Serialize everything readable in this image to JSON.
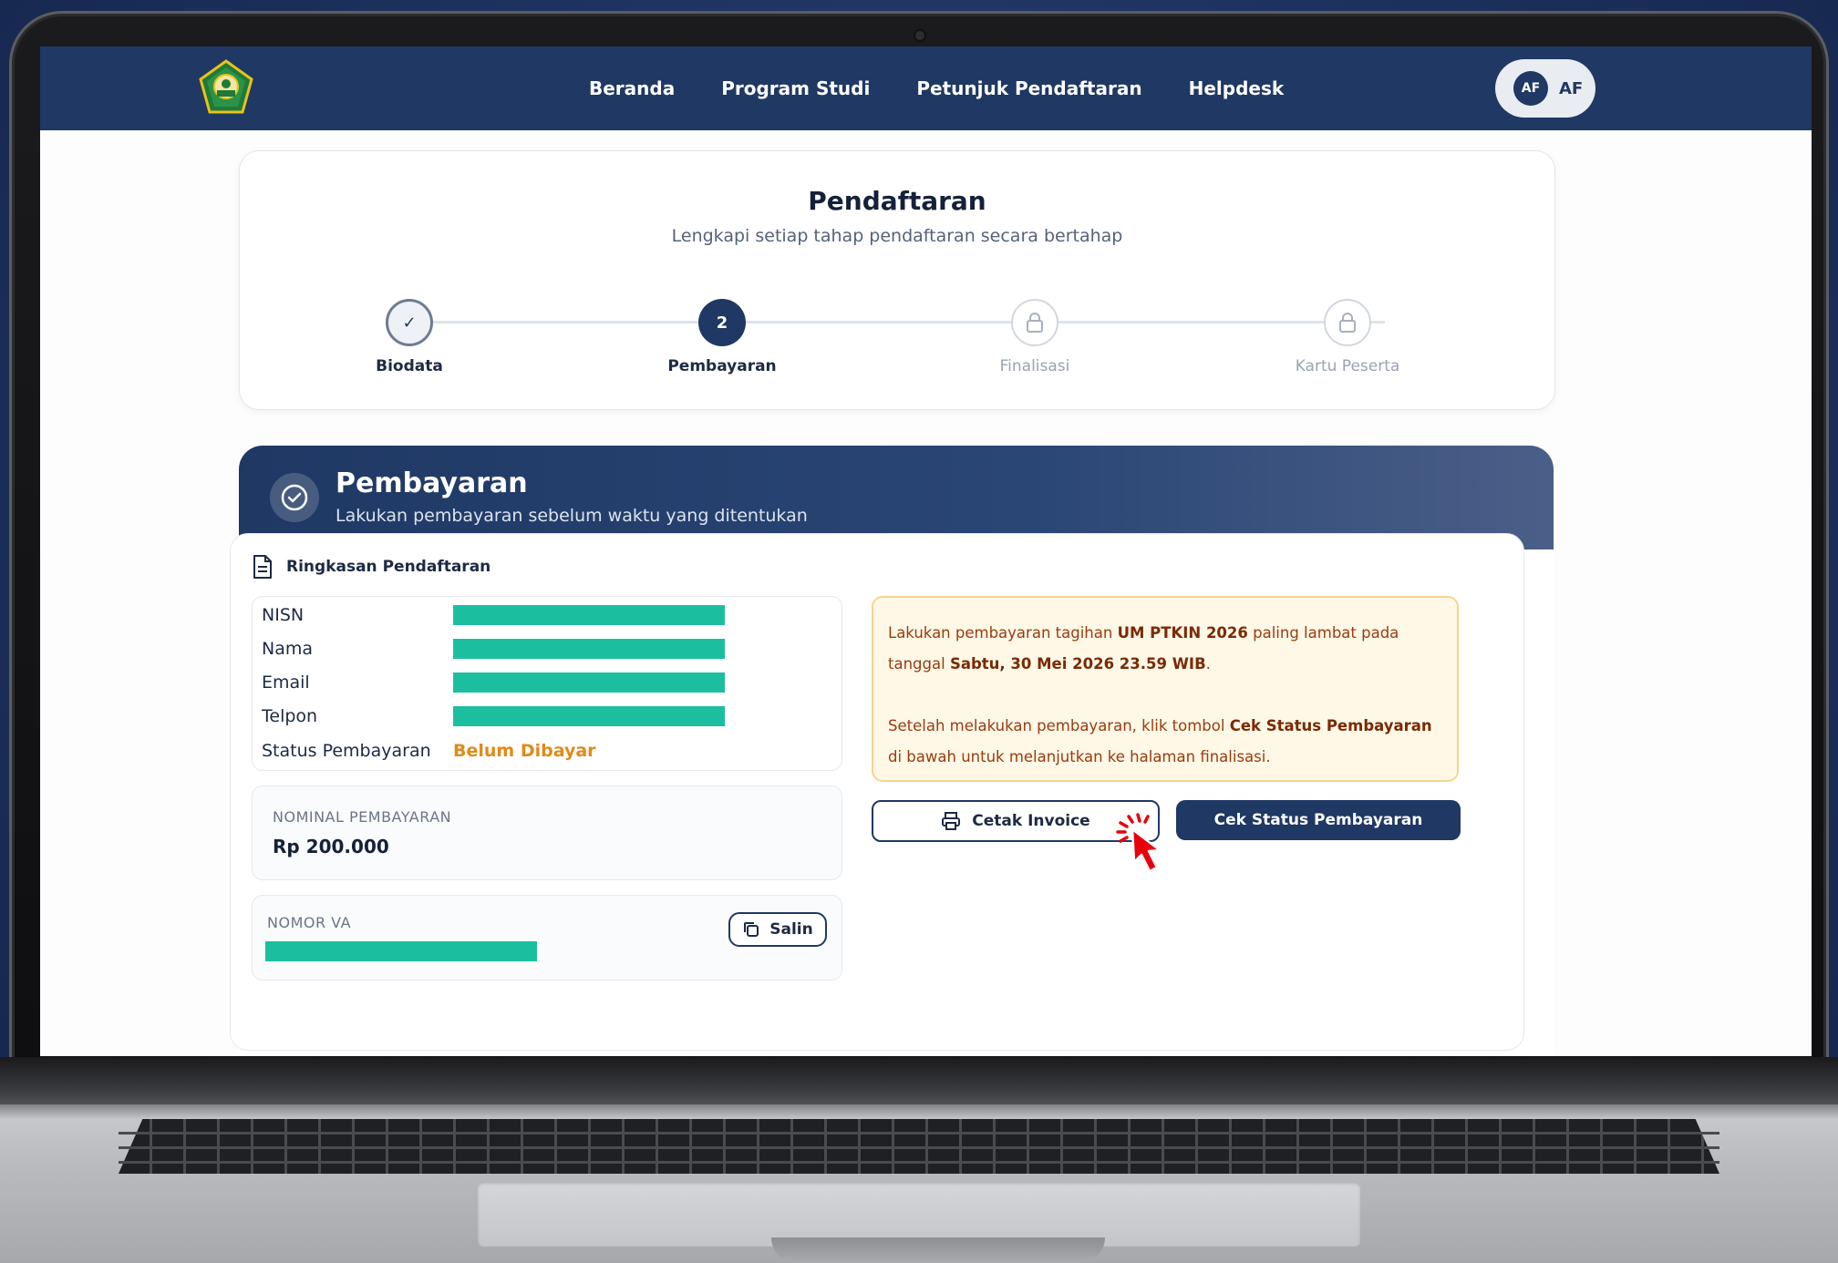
{
  "navbar": {
    "links": [
      "Beranda",
      "Program Studi",
      "Petunjuk Pendaftaran",
      "Helpdesk"
    ],
    "user_avatar": "AF",
    "user_initials": "AF"
  },
  "steps": {
    "title": "Pendaftaran",
    "subtitle": "Lengkapi setiap tahap pendaftaran secara bertahap",
    "items": [
      {
        "label": "Biodata",
        "state": "done",
        "marker": "✓"
      },
      {
        "label": "Pembayaran",
        "state": "active",
        "marker": "2"
      },
      {
        "label": "Finalisasi",
        "state": "locked",
        "marker": "lock-icon"
      },
      {
        "label": "Kartu Peserta",
        "state": "locked",
        "marker": "lock-icon"
      }
    ]
  },
  "payment": {
    "title": "Pembayaran",
    "subtitle": "Lakukan pembayaran sebelum waktu yang ditentukan",
    "summary_title": "Ringkasan Pendaftaran",
    "fields": [
      {
        "key": "NISN",
        "value": ""
      },
      {
        "key": "Nama",
        "value": ""
      },
      {
        "key": "Email",
        "value": ""
      },
      {
        "key": "Telpon",
        "value": ""
      },
      {
        "key": "Status Pembayaran",
        "value": "Belum Dibayar"
      }
    ],
    "nominal_label": "NOMINAL PEMBAYARAN",
    "nominal_value": "Rp  200.000",
    "va_label": "NOMOR VA",
    "copy_label": "Salin",
    "notice": {
      "p1_a": "Lakukan pembayaran tagihan ",
      "p1_b": "UM PTKIN 2026",
      "p1_c": " paling lambat pada tanggal ",
      "p1_d": "Sabtu, 30 Mei 2026 23.59 WIB",
      "p1_e": ".",
      "p2_a": "Setelah melakukan pembayaran, klik tombol ",
      "p2_b": "Cek Status Pembayaran",
      "p2_c": " di bawah untuk melanjutkan ke halaman finalisasi."
    },
    "invoice_button": "Cetak Invoice",
    "status_button": "Cek Status Pembayaran"
  },
  "colors": {
    "navy": "#1f3864",
    "redaction": "#1bbfa0",
    "status_unpaid": "#e08a1a",
    "notice_bg": "#fff8e6",
    "cursor": "#e8000b"
  }
}
